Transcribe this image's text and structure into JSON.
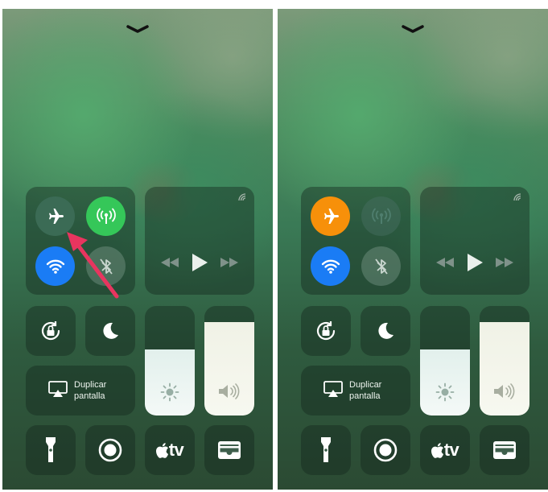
{
  "panels": [
    {
      "id": "left",
      "connectivity": {
        "airplane_mode": false,
        "cellular_data": true,
        "wifi": true,
        "bluetooth": false
      },
      "screen_mirroring": {
        "line1": "Duplicar",
        "line2": "pantalla"
      },
      "brightness_level": 0.6,
      "volume_level": 0.85,
      "annotation": "red arrow pointing to airplane mode button"
    },
    {
      "id": "right",
      "connectivity": {
        "airplane_mode": true,
        "cellular_data": false,
        "wifi": true,
        "bluetooth": false
      },
      "screen_mirroring": {
        "line1": "Duplicar",
        "line2": "pantalla"
      },
      "brightness_level": 0.6,
      "volume_level": 0.85
    }
  ],
  "apple_tv_label": "tv",
  "colors": {
    "airplane_on": "#f7900a",
    "airplane_off": "#3b6b55",
    "cellular_on": "#35c759",
    "wifi_on": "#1a7cf5",
    "arrow": "#e8355f"
  },
  "icons": [
    "chevron-down-icon",
    "airplane-icon",
    "antenna-icon",
    "wifi-icon",
    "bluetooth-off-icon",
    "airplay-icon",
    "rewind-icon",
    "play-icon",
    "fast-forward-icon",
    "rotation-lock-icon",
    "moon-icon",
    "sun-icon",
    "speaker-icon",
    "flashlight-icon",
    "record-icon",
    "apple-icon",
    "wallet-icon"
  ]
}
